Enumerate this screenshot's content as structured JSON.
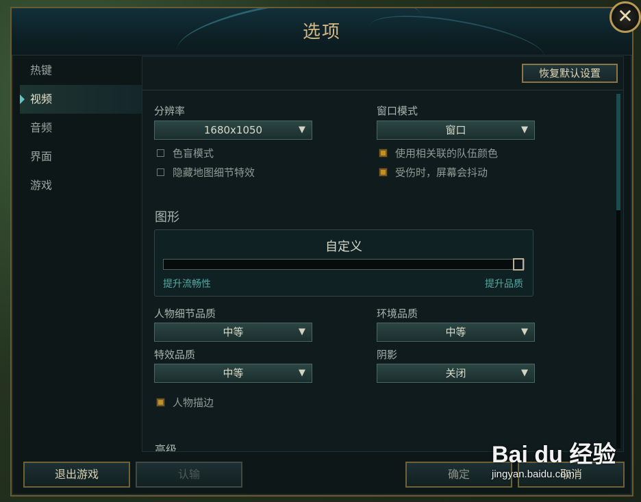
{
  "window": {
    "title": "选项",
    "close_symbol": "✕"
  },
  "sidebar": {
    "items": [
      {
        "label": "热键",
        "active": false
      },
      {
        "label": "视频",
        "active": true
      },
      {
        "label": "音频",
        "active": false
      },
      {
        "label": "界面",
        "active": false
      },
      {
        "label": "游戏",
        "active": false
      }
    ]
  },
  "header": {
    "reset_label": "恢复默认设置"
  },
  "display": {
    "resolution_label": "分辨率",
    "resolution_value": "1680x1050",
    "window_mode_label": "窗口模式",
    "window_mode_value": "窗口",
    "colorblind_label": "色盲模式",
    "colorblind_checked": false,
    "hide_map_detail_label": "隐藏地图细节特效",
    "hide_map_detail_checked": false,
    "team_colors_label": "使用相关联的队伍颜色",
    "team_colors_checked": true,
    "screen_shake_label": "受伤时，屏幕会抖动",
    "screen_shake_checked": true
  },
  "graphics": {
    "section_title": "图形",
    "preset_label": "自定义",
    "left_label": "提升流畅性",
    "right_label": "提升品质",
    "slider_value": 1.0,
    "character_quality_label": "人物细节品质",
    "character_quality_value": "中等",
    "environment_quality_label": "环境品质",
    "environment_quality_value": "中等",
    "effects_quality_label": "特效品质",
    "effects_quality_value": "中等",
    "shadows_label": "阴影",
    "shadows_value": "关闭",
    "character_outline_label": "人物描边",
    "character_outline_checked": true
  },
  "advanced": {
    "section_title": "高级"
  },
  "footer": {
    "exit_label": "退出游戏",
    "surrender_label": "认输",
    "confirm_label": "确定",
    "cancel_label": "取消"
  },
  "watermark": {
    "brand": "Bai du 经验",
    "url": "jingyan.baidu.com"
  },
  "colors": {
    "accent_gold": "#c0902a",
    "accent_teal": "#5fc6c6",
    "title_gold": "#d4b985"
  },
  "icons": {
    "dropdown": "triangle-down-icon",
    "close": "close-icon",
    "active_marker": "chevron-right-icon"
  }
}
